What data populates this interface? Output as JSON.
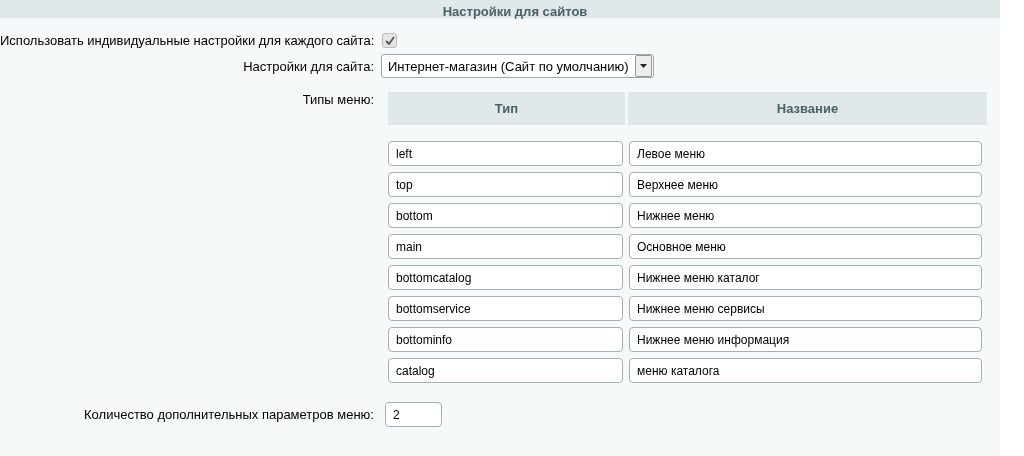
{
  "section_title": "Настройки для сайтов",
  "individual_settings": {
    "label": "Использовать индивидуальные настройки для каждого сайта:",
    "checked": true
  },
  "site_settings": {
    "label": "Настройки для сайта:",
    "value": "Интернет-магазин (Сайт по умолчанию)"
  },
  "menu_types": {
    "label": "Типы меню:",
    "columns": [
      "Тип",
      "Название"
    ],
    "rows": [
      {
        "type": "left",
        "name": "Левое меню"
      },
      {
        "type": "top",
        "name": "Верхнее меню"
      },
      {
        "type": "bottom",
        "name": "Нижнее меню"
      },
      {
        "type": "main",
        "name": "Основное меню"
      },
      {
        "type": "bottomcatalog",
        "name": "Нижнее меню каталог"
      },
      {
        "type": "bottomservice",
        "name": "Нижнее меню сервисы"
      },
      {
        "type": "bottominfo",
        "name": "Нижнее меню информация"
      },
      {
        "type": "catalog",
        "name": "меню каталога"
      }
    ]
  },
  "extra_params": {
    "label": "Количество дополнительных параметров меню:",
    "value": "2"
  }
}
